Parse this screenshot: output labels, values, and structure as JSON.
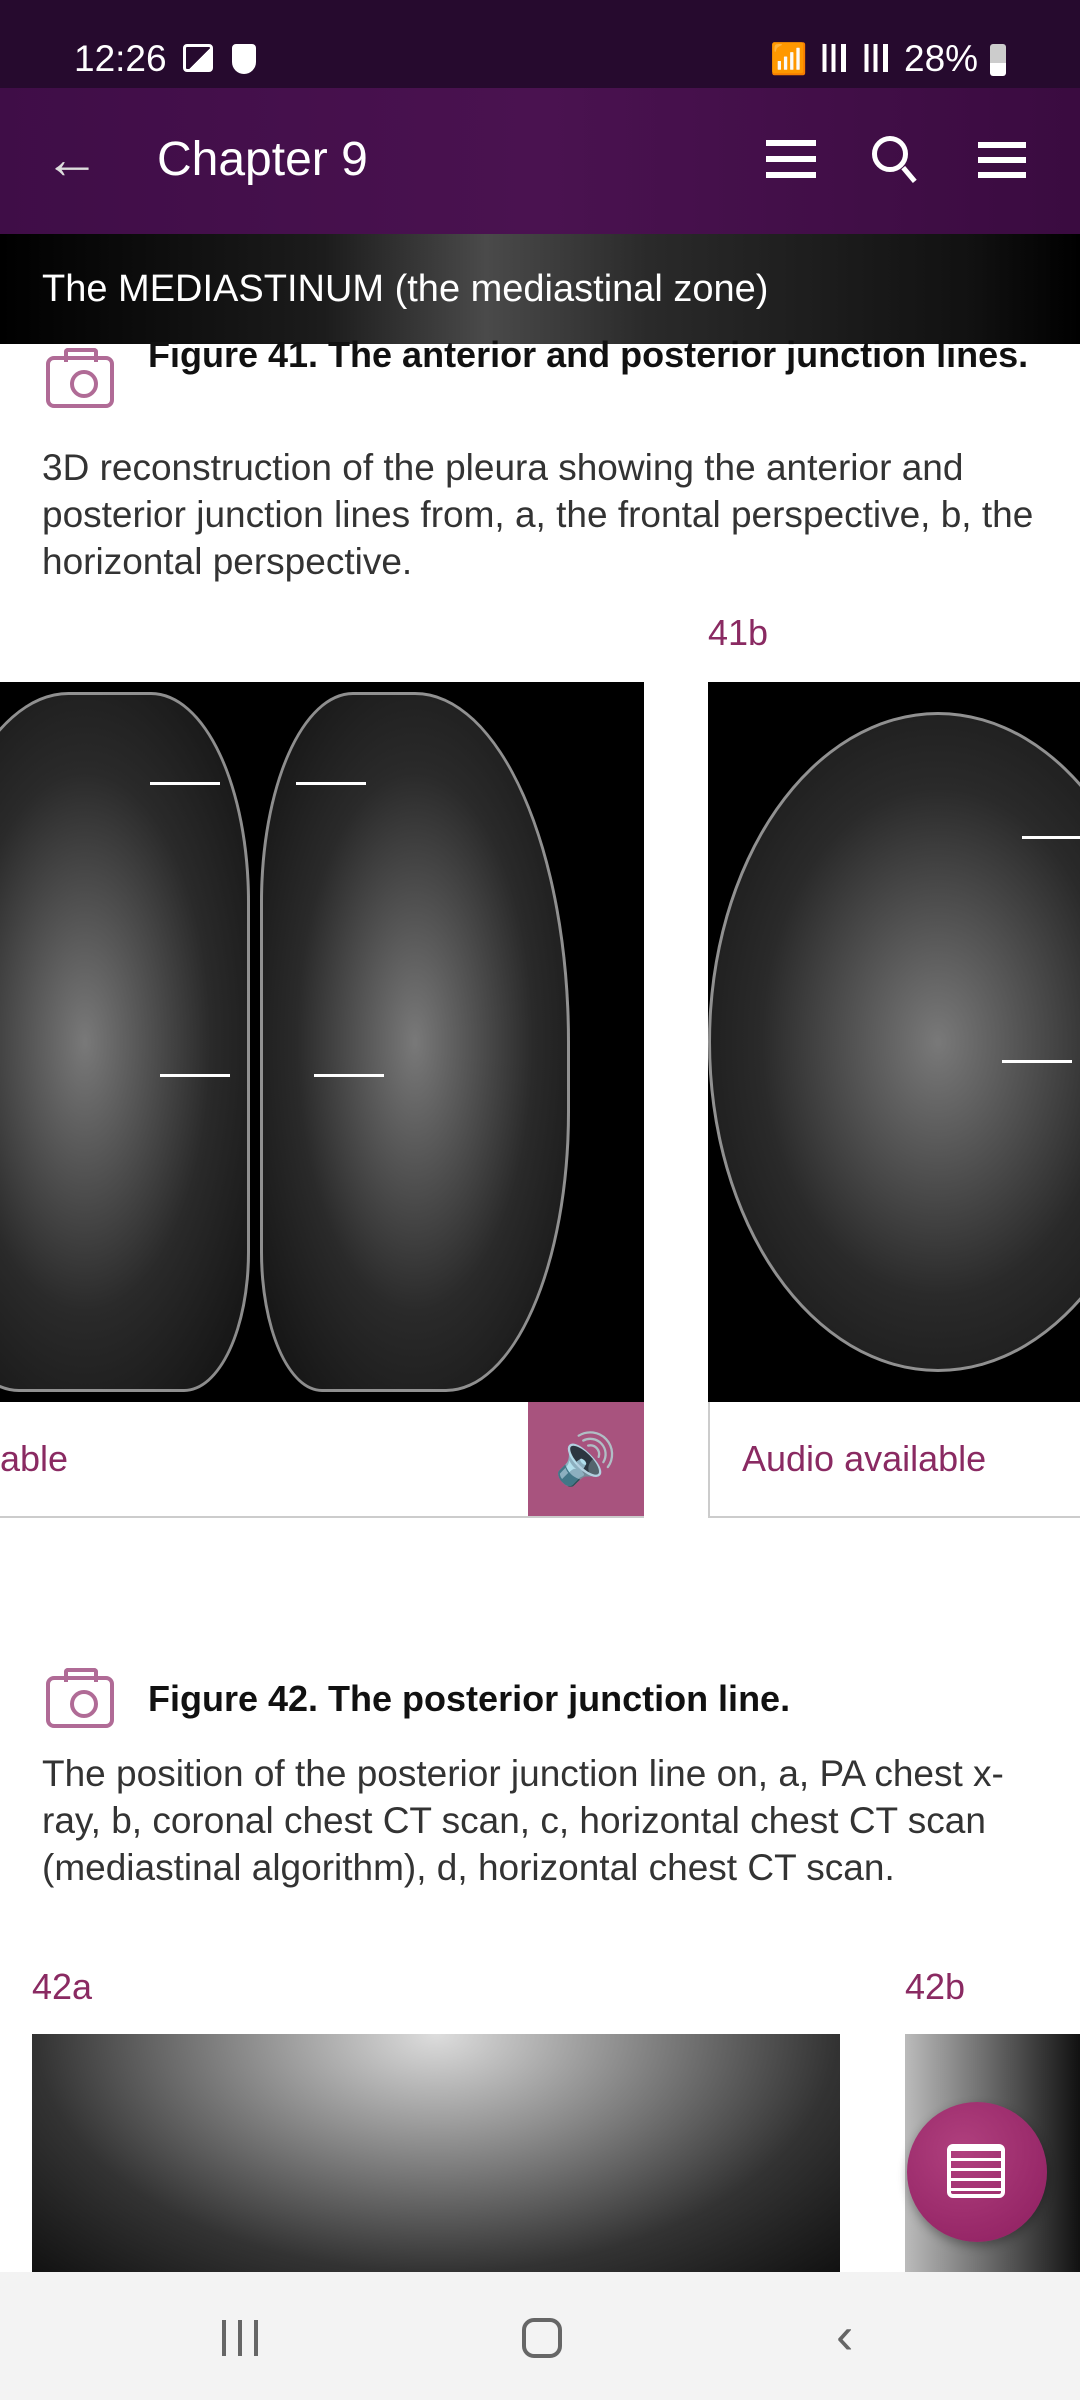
{
  "status_bar": {
    "time": "12:26",
    "battery": "28%",
    "icons": [
      "image-icon",
      "shield-icon",
      "wifi-icon",
      "signal-icon",
      "signal-icon",
      "battery-icon"
    ]
  },
  "app_bar": {
    "title": "Chapter 9",
    "icons": [
      "back-arrow-icon",
      "list-icon",
      "search-icon",
      "menu-icon"
    ]
  },
  "banner": {
    "title": "The MEDIASTINUM (the mediastinal zone)"
  },
  "figure41": {
    "title": "Figure 41. The anterior and posterior junction lines.",
    "description": "3D reconstruction of the pleura showing the anterior and posterior junction lines from, a, the frontal perspective, b, the horizontal perspective.",
    "panels": [
      {
        "label": "",
        "audio_text": "able"
      },
      {
        "label": "41b",
        "audio_text": "Audio available"
      }
    ]
  },
  "figure42": {
    "title": "Figure 42. The posterior junction line.",
    "description": "The position of the posterior junction line on, a, PA chest x-ray, b, coronal chest CT scan, c, horizontal chest CT scan (mediastinal algorithm), d, horizontal chest CT scan.",
    "panels": [
      {
        "label": "42a"
      },
      {
        "label": "42b"
      }
    ]
  },
  "colors": {
    "accent": "#8a2a62",
    "audio_button": "#a8537e",
    "app_bar": "#3f0d47"
  }
}
